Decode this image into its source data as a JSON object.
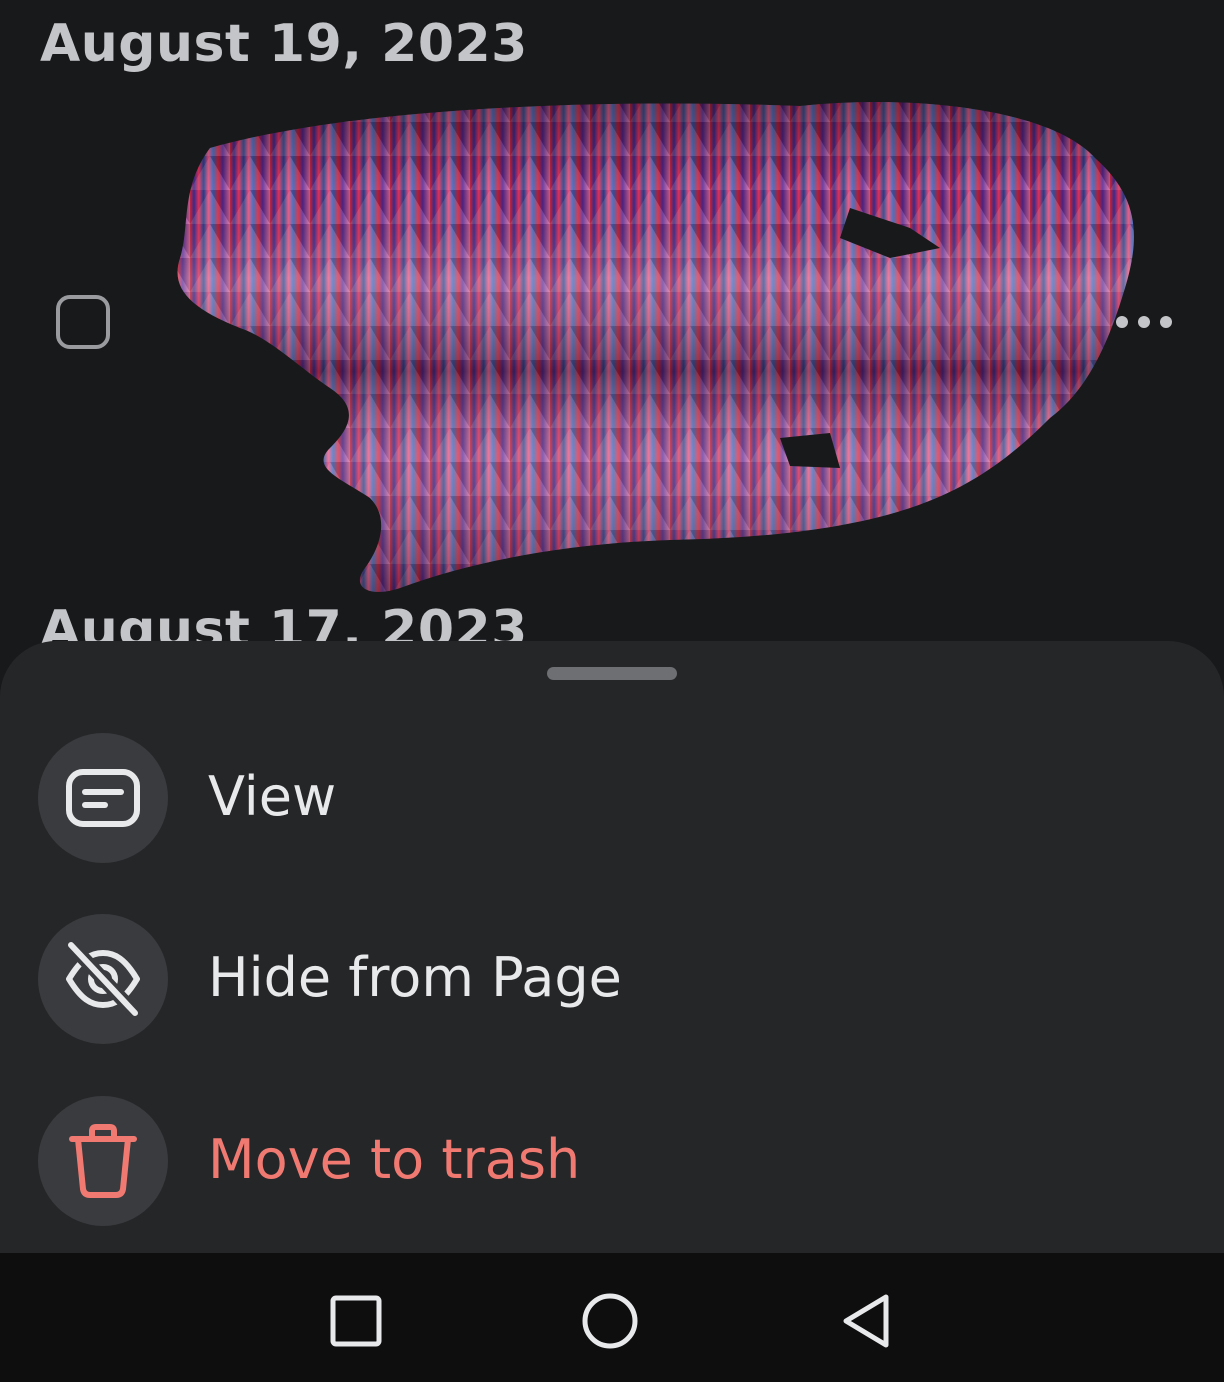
{
  "feed": {
    "date_headers": [
      "August 19, 2023",
      "August 17, 2023"
    ]
  },
  "sheet": {
    "menu": [
      {
        "label": "View",
        "icon": "post-icon"
      },
      {
        "label": "Hide from Page",
        "icon": "eye-off-icon"
      },
      {
        "label": "Move to trash",
        "icon": "trash-icon"
      }
    ]
  },
  "navbar": {
    "buttons": [
      "recents-button",
      "home-button",
      "back-button"
    ]
  },
  "colors": {
    "background": "#18191b",
    "sheet": "#252628",
    "danger": "#f07a72"
  }
}
